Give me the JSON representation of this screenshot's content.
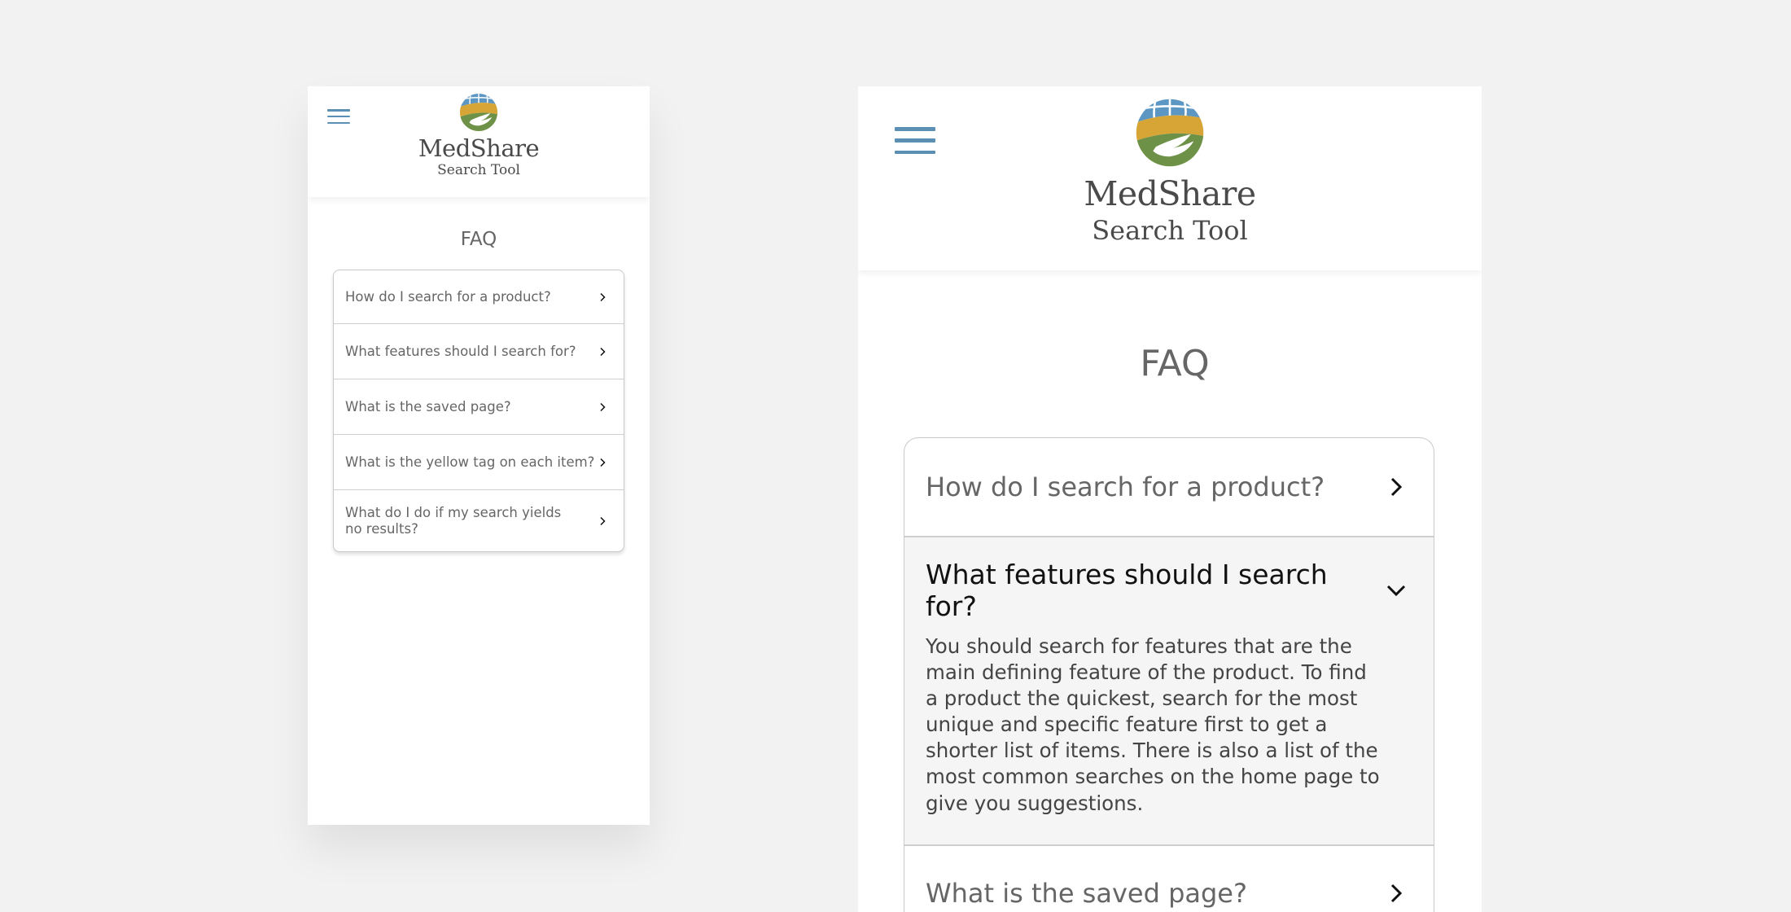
{
  "brand": {
    "name": "MedShare",
    "subtitle": "Search Tool",
    "colors": {
      "globe": "#5b97c2",
      "band": "#d7a536",
      "hand": "#6e9148",
      "menu": "#5b8fb3"
    }
  },
  "menu_icon": "hamburger-menu-icon",
  "faq": {
    "title": "FAQ",
    "items": [
      {
        "question": "How do I search for a product?"
      },
      {
        "question": "What features should I search for?"
      },
      {
        "question": "What is the saved page?"
      },
      {
        "question": "What is the yellow tag on each item?"
      },
      {
        "question": "What do I do if my search yields no results?"
      }
    ],
    "expanded_answer": "You should search for features that are the main defining feature of the product. To find a product the quickest, search for the most unique and specific feature first to get a shorter list of items. There is also a list of the most common searches on the home page to give you suggestions."
  }
}
